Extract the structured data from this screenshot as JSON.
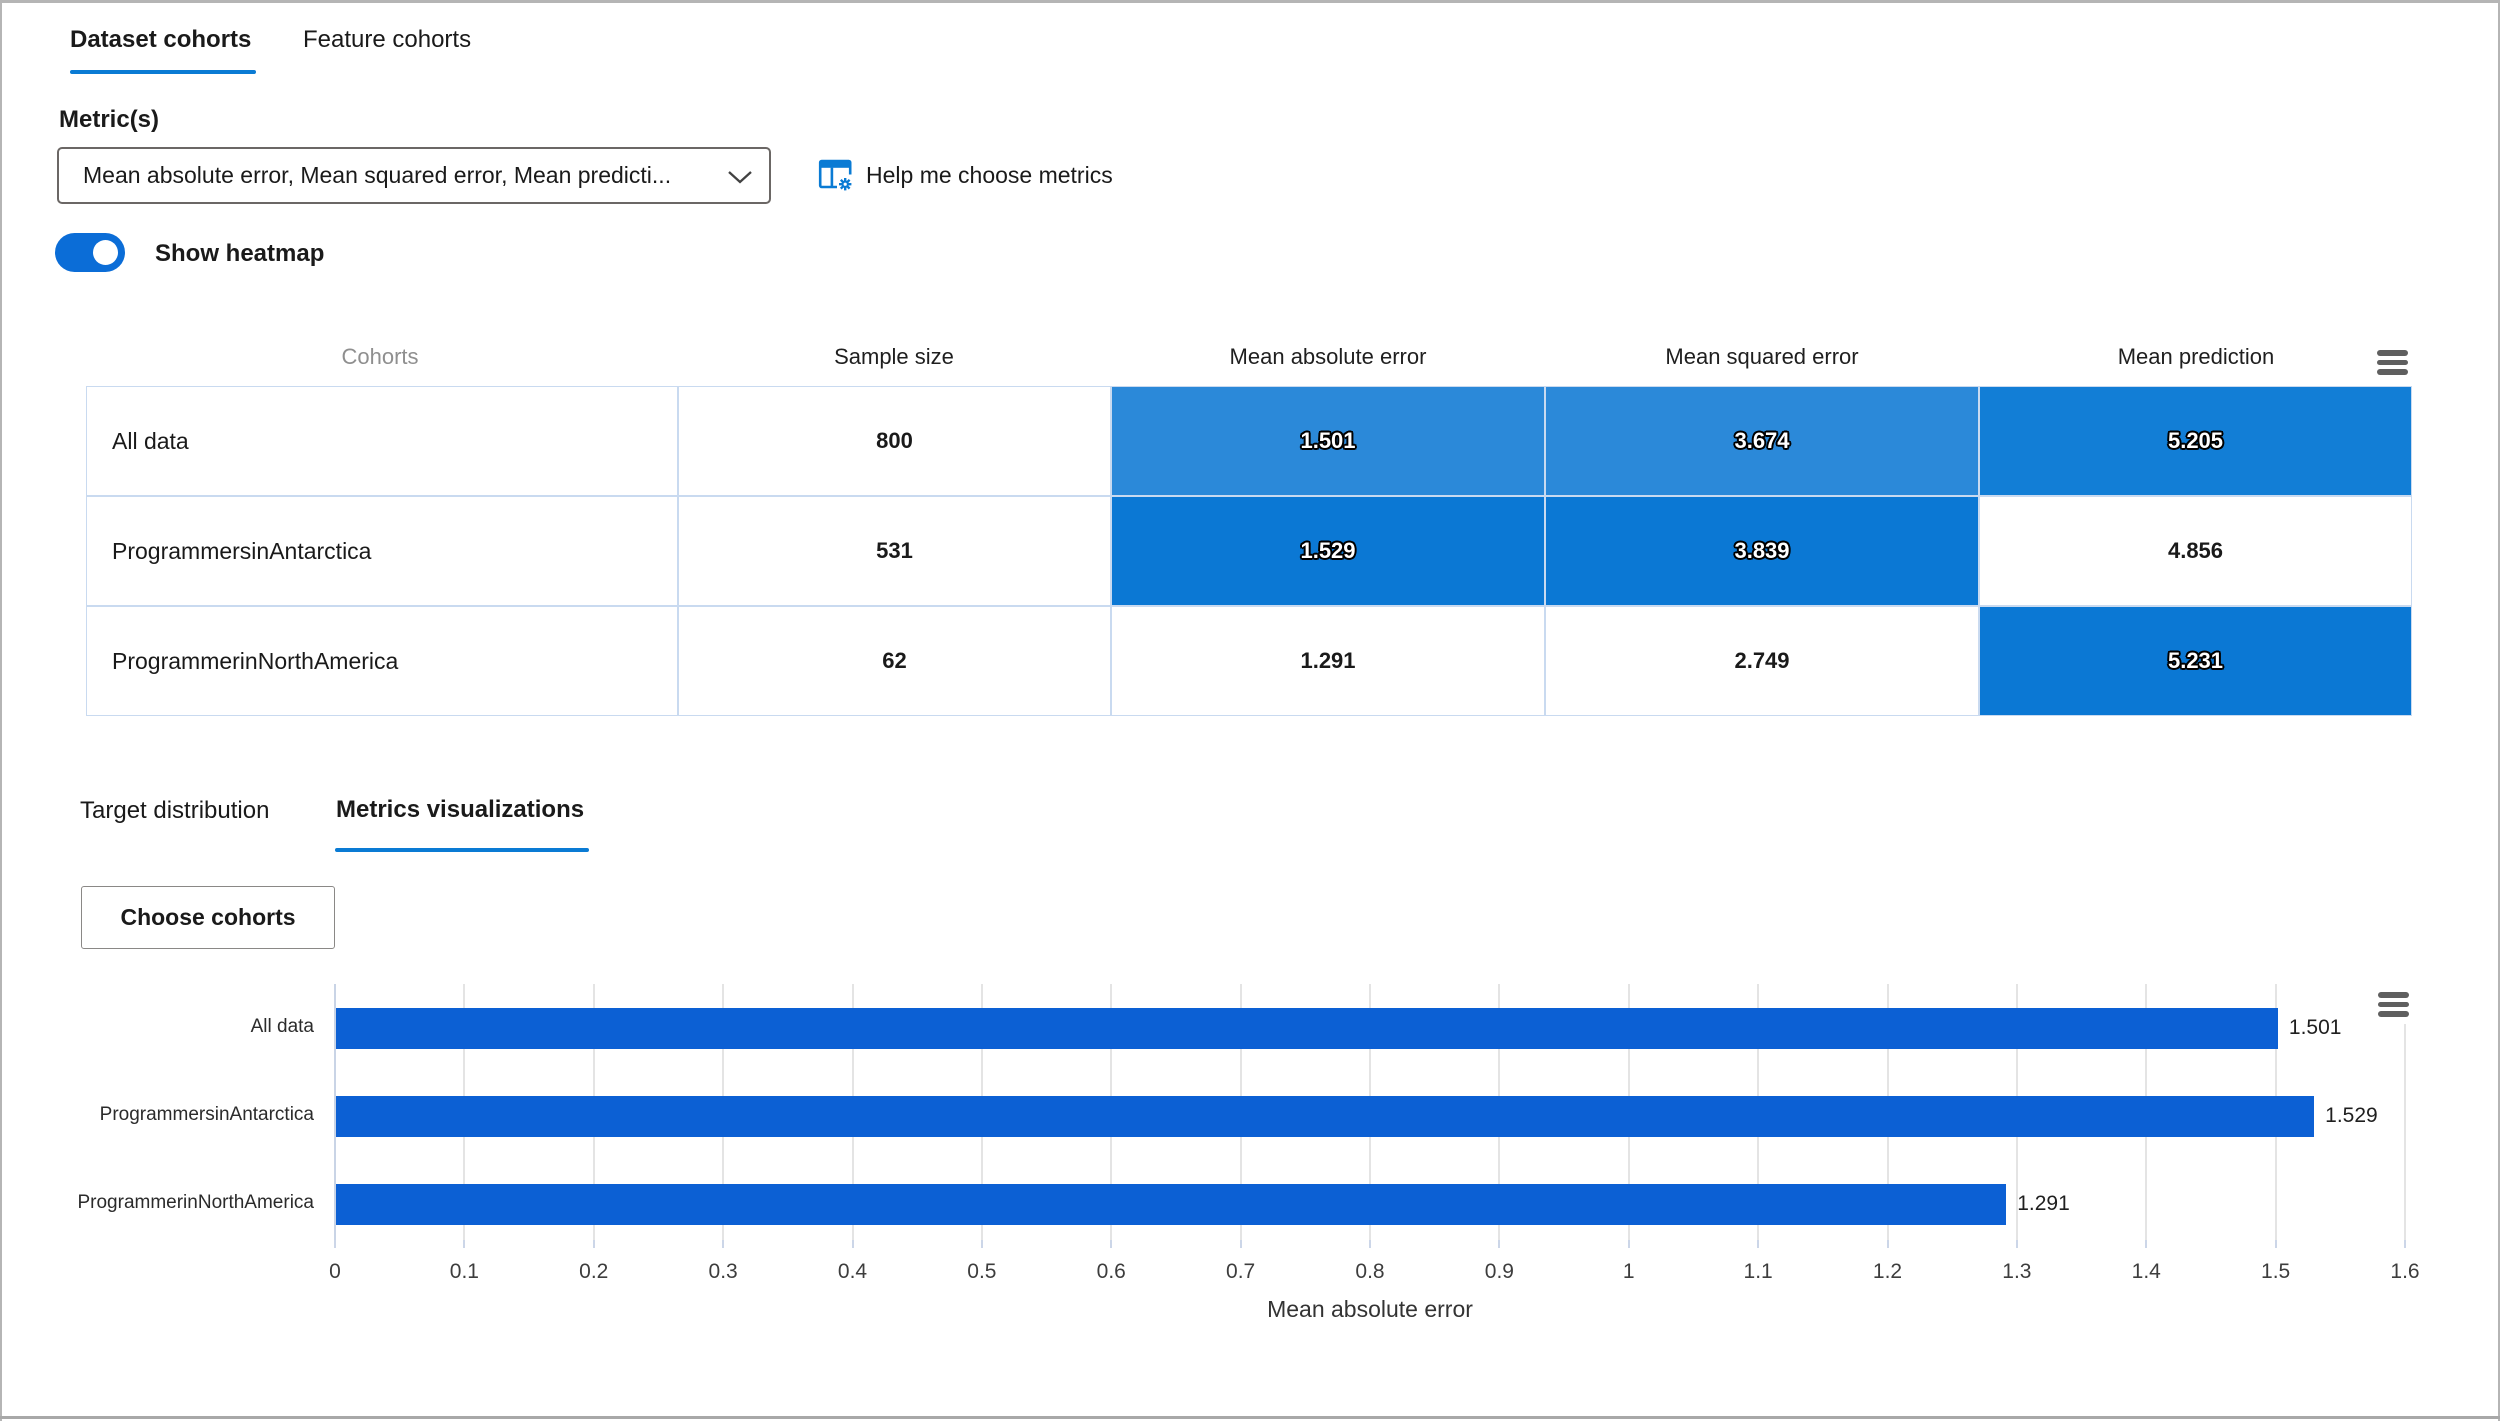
{
  "tabs_primary": [
    {
      "label": "Dataset cohorts",
      "active": true
    },
    {
      "label": "Feature cohorts",
      "active": false
    }
  ],
  "metrics": {
    "label": "Metric(s)",
    "dropdown_value": "Mean absolute error, Mean squared error, Mean predicti...",
    "help_label": "Help me choose metrics"
  },
  "heatmap_toggle": {
    "label": "Show heatmap",
    "on": true
  },
  "cohort_table": {
    "columns": [
      "Cohorts",
      "Sample size",
      "Mean absolute error",
      "Mean squared error",
      "Mean prediction"
    ],
    "rows": [
      {
        "cohort": "All data",
        "sample_size": "800",
        "metrics": [
          {
            "value": "1.501",
            "bg": "#2b89d9",
            "heat": true
          },
          {
            "value": "3.674",
            "bg": "#2b89d9",
            "heat": true
          },
          {
            "value": "5.205",
            "bg": "#127ed6",
            "heat": true
          }
        ]
      },
      {
        "cohort": "ProgrammersinAntarctica",
        "sample_size": "531",
        "metrics": [
          {
            "value": "1.529",
            "bg": "#0b78d4",
            "heat": true
          },
          {
            "value": "3.839",
            "bg": "#0b78d4",
            "heat": true
          },
          {
            "value": "4.856",
            "bg": "",
            "heat": false
          }
        ]
      },
      {
        "cohort": "ProgrammerinNorthAmerica",
        "sample_size": "62",
        "metrics": [
          {
            "value": "1.291",
            "bg": "",
            "heat": false
          },
          {
            "value": "2.749",
            "bg": "",
            "heat": false
          },
          {
            "value": "5.231",
            "bg": "#0b78d4",
            "heat": true
          }
        ]
      }
    ]
  },
  "tabs_secondary": [
    {
      "label": "Target distribution",
      "active": false
    },
    {
      "label": "Metrics visualizations",
      "active": true
    }
  ],
  "choose_cohorts": {
    "label": "Choose cohorts"
  },
  "chart_data": {
    "type": "bar",
    "orientation": "horizontal",
    "title": "",
    "categories": [
      "All data",
      "ProgrammersinAntarctica",
      "ProgrammerinNorthAmerica"
    ],
    "values": [
      1.501,
      1.529,
      1.291
    ],
    "value_labels": [
      "1.501",
      "1.529",
      "1.291"
    ],
    "xlabel": "Mean absolute error",
    "ylabel": "",
    "xlim": [
      0,
      1.6
    ],
    "xtick_labels": [
      "0",
      "0.1",
      "0.2",
      "0.3",
      "0.4",
      "0.5",
      "0.6",
      "0.7",
      "0.8",
      "0.9",
      "1",
      "1.1",
      "1.2",
      "1.3",
      "1.4",
      "1.5",
      "1.6"
    ],
    "bar_color": "#0c60d4",
    "grid": true,
    "legend": false
  },
  "colors": {
    "accent": "#0a7bd4",
    "heatmap_full": "#0b78d4",
    "heatmap_light": "#2b89d9",
    "table_border": "#c9daf0"
  }
}
